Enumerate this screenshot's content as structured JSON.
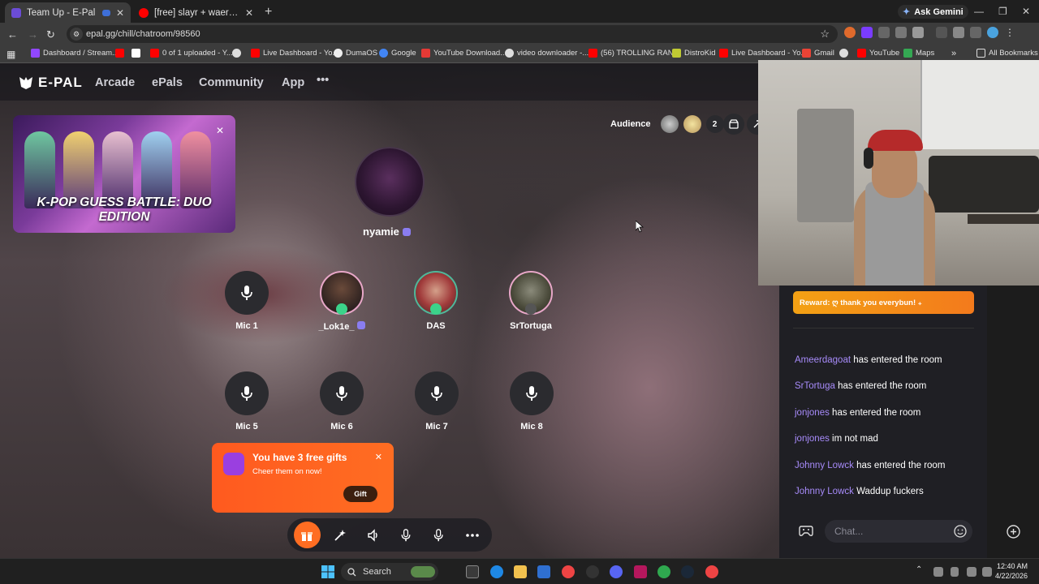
{
  "browser": {
    "tabs": [
      {
        "title": "Team Up - E-Pal",
        "active": true
      },
      {
        "title": "[free] slayr + waera type beat -",
        "active": false
      }
    ],
    "gemini_label": "Ask Gemini",
    "url": "epal.gg/chill/chatroom/98560",
    "bookmarks": [
      "Dashboard / Stream...",
      "0 of 1 uploaded - Y...",
      "Live Dashboard - Yo...",
      "DumaOS",
      "Google",
      "YouTube Download...",
      "video downloader -...",
      "(56) TROLLING RAN...",
      "DistroKid",
      "Live Dashboard - Yo...",
      "Gmail",
      "YouTube",
      "Maps"
    ],
    "all_bookmarks": "All Bookmarks"
  },
  "site": {
    "logo": "E-PAL",
    "nav": [
      "Arcade",
      "ePals",
      "Community",
      "App"
    ],
    "more": "•••"
  },
  "banner": {
    "title": "K-POP GUESS BATTLE: DUO EDITION"
  },
  "audience": {
    "label": "Audience",
    "count": "2"
  },
  "host": {
    "name": "nyamie"
  },
  "seats": [
    {
      "label": "Mic 1",
      "avatar": false
    },
    {
      "label": "_Lok1e_",
      "avatar": true
    },
    {
      "label": "DAS",
      "avatar": true
    },
    {
      "label": "SrTortuga",
      "avatar": true
    },
    {
      "label": "Mic 5",
      "avatar": false
    },
    {
      "label": "Mic 6",
      "avatar": false
    },
    {
      "label": "Mic 7",
      "avatar": false
    },
    {
      "label": "Mic 8",
      "avatar": false
    }
  ],
  "gift_popup": {
    "title": "You have 3 free gifts",
    "subtitle": "Cheer them on now!",
    "button": "Gift"
  },
  "chat": {
    "reward": "Reward: ღ thank you everybun! ₊",
    "messages": [
      {
        "user": "Ameerdagoat",
        "text": "has entered the room"
      },
      {
        "user": "SrTortuga",
        "text": "has entered the room"
      },
      {
        "user": "jonjones",
        "text": "has entered the room"
      },
      {
        "user": "jonjones",
        "text": "im not mad"
      },
      {
        "user": "Johnny Lowck",
        "text": "has entered the room"
      },
      {
        "user": "Johnny Lowck",
        "text": "Waddup fuckers"
      }
    ],
    "input_placeholder": "Chat..."
  },
  "taskbar": {
    "search": "Search",
    "time": "12:40 AM",
    "date": "4/22/2026"
  },
  "colors": {
    "accent": "#ff6d22",
    "username": "#a78bfa",
    "mic_active": "#3bd38a"
  }
}
